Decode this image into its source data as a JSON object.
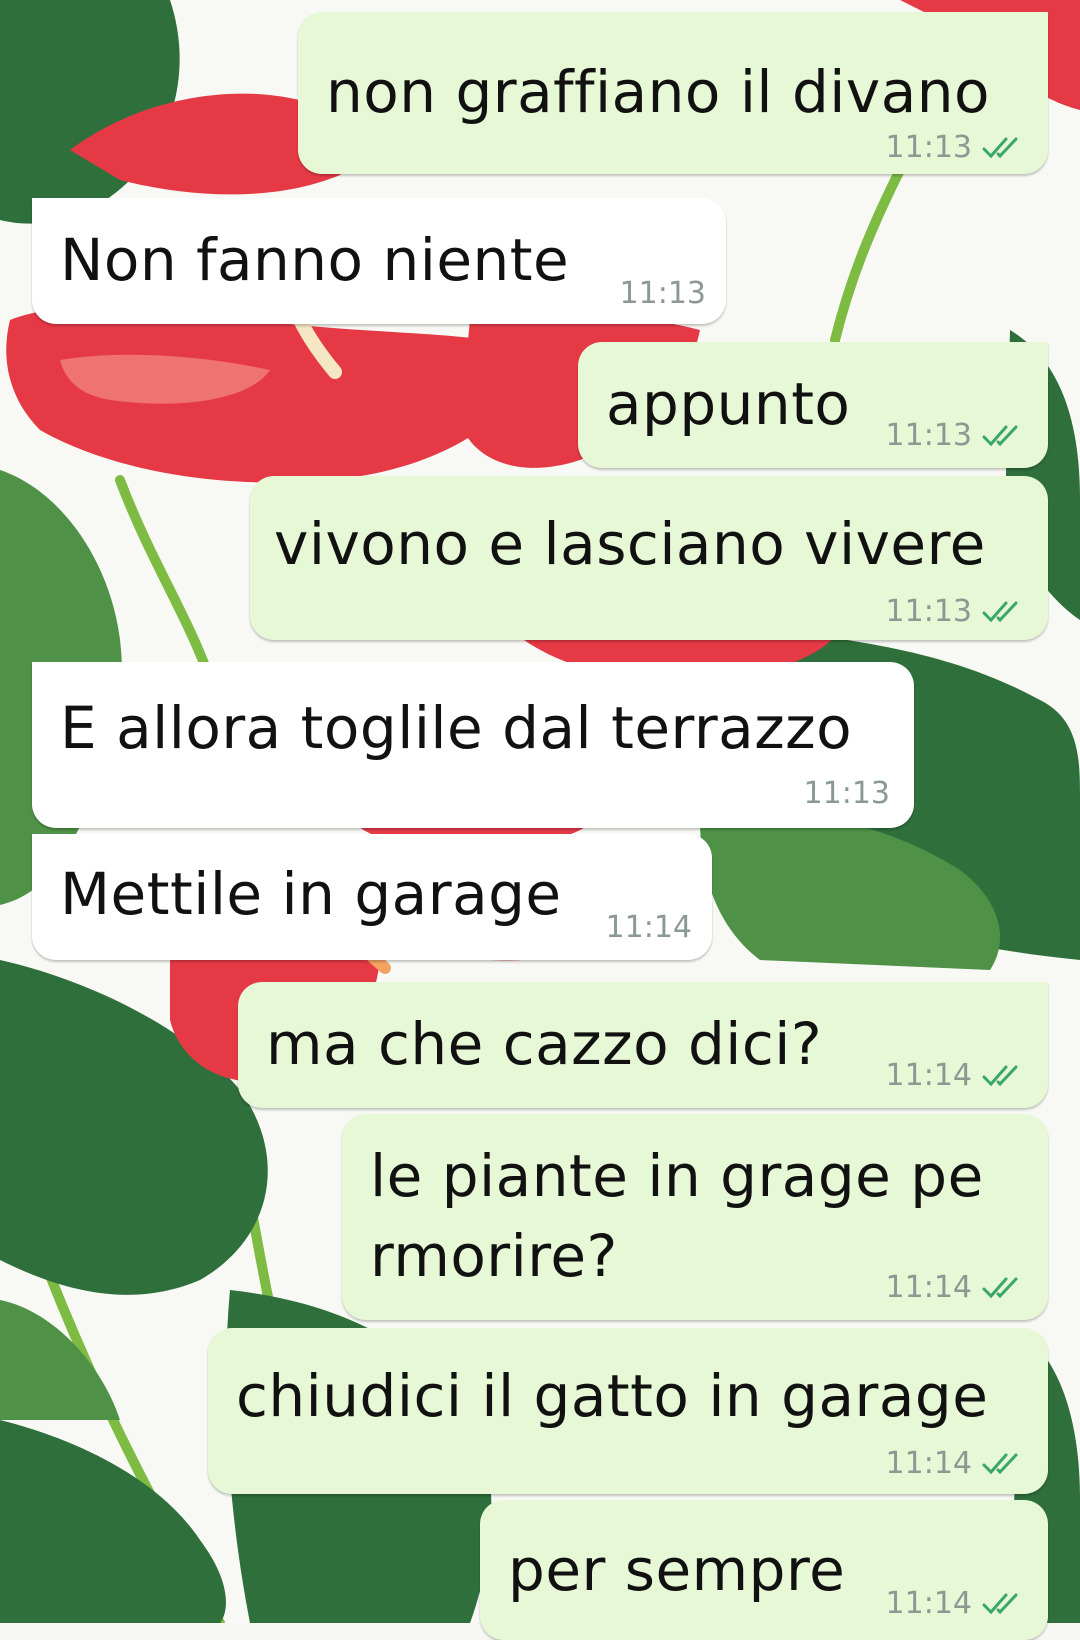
{
  "messages": [
    {
      "dir": "out",
      "text": "non graffiano il divano",
      "time": "11:13",
      "status": "read-double-check-icon"
    },
    {
      "dir": "in",
      "text": "Non fanno niente",
      "time": "11:13"
    },
    {
      "dir": "out",
      "text": "appunto",
      "time": "11:13",
      "status": "read-double-check-icon"
    },
    {
      "dir": "out",
      "text": "vivono e lasciano vivere",
      "time": "11:13",
      "status": "read-double-check-icon"
    },
    {
      "dir": "in",
      "text": "E allora toglile dal terrazzo",
      "time": "11:13"
    },
    {
      "dir": "in",
      "text": "Mettile in garage",
      "time": "11:14"
    },
    {
      "dir": "out",
      "text": "ma che cazzo dici?",
      "time": "11:14",
      "status": "read-double-check-icon"
    },
    {
      "dir": "out",
      "text": "le piante in grage pe",
      "text2": "rmorire?",
      "time": "11:14",
      "status": "read-double-check-icon"
    },
    {
      "dir": "out",
      "text": "chiudici il gatto in garage",
      "time": "11:14",
      "status": "read-double-check-icon"
    },
    {
      "dir": "out",
      "text": "per sempre",
      "time": "11:14",
      "status": "read-double-check-icon"
    }
  ],
  "colors": {
    "outgoing_bubble": "#e6f8d6",
    "incoming_bubble": "#ffffff",
    "timestamp": "#8a9a93",
    "read_ticks": "#3aa66b"
  }
}
